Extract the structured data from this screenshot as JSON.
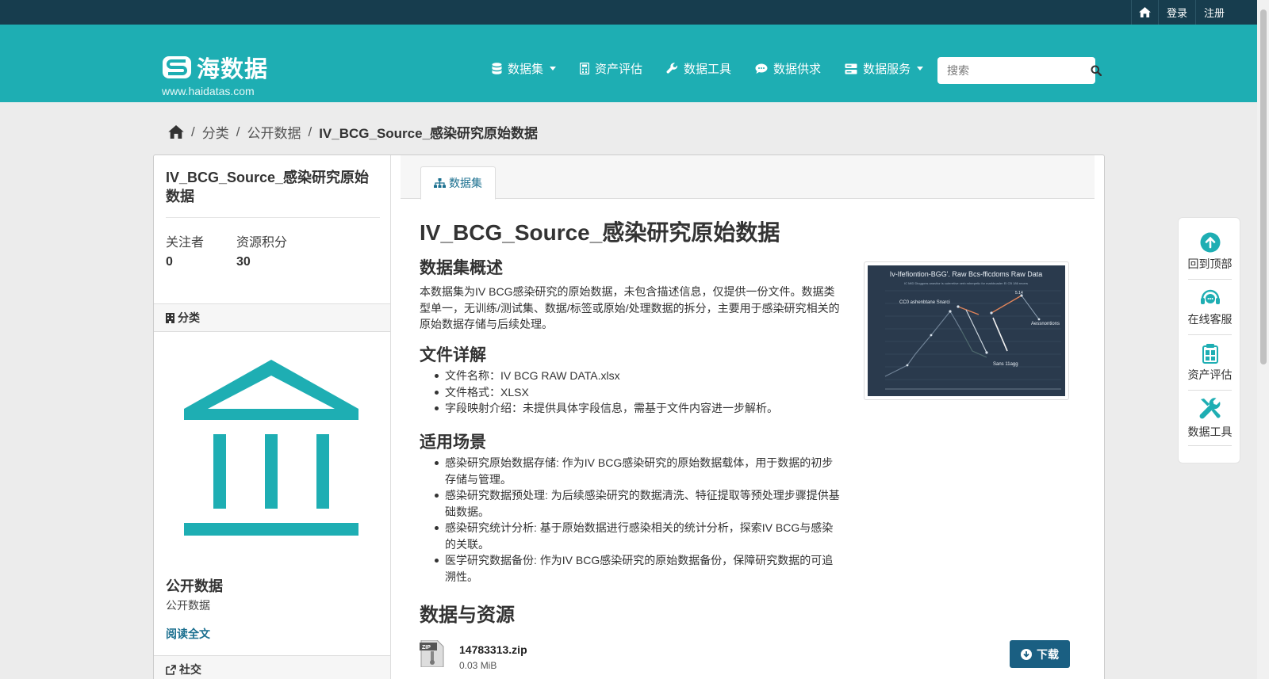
{
  "topbar": {
    "login": "登录",
    "register": "注册"
  },
  "header": {
    "logo_text": "海数据",
    "logo_url": "www.haidatas.com",
    "nav": [
      {
        "label": "数据集",
        "has_dropdown": true,
        "icon": "database-icon"
      },
      {
        "label": "资产评估",
        "has_dropdown": false,
        "icon": "calculator-icon"
      },
      {
        "label": "数据工具",
        "has_dropdown": false,
        "icon": "wrench-icon"
      },
      {
        "label": "数据供求",
        "has_dropdown": false,
        "icon": "comment-icon"
      },
      {
        "label": "数据服务",
        "has_dropdown": true,
        "icon": "server-icon"
      }
    ],
    "search_placeholder": "搜索"
  },
  "breadcrumb": [
    "分类",
    "公开数据",
    "IV_BCG_Source_感染研究原始数据"
  ],
  "sidebar": {
    "title": "IV_BCG_Source_感染研究原始数据",
    "followers_label": "关注者",
    "followers_value": "0",
    "points_label": "资源积分",
    "points_value": "30",
    "category_heading": "分类",
    "org_name": "公开数据",
    "org_desc": "公开数据",
    "read_more": "阅读全文",
    "social_heading": "社交"
  },
  "content": {
    "tab_label": "数据集",
    "title": "IV_BCG_Source_感染研究原始数据",
    "overview_heading": "数据集概述",
    "overview_text": "本数据集为IV BCG感染研究的原始数据，未包含描述信息，仅提供一份文件。数据类型单一，无训练/测试集、数据/标签或原始/处理数据的拆分，主要用于感染研究相关的原始数据存储与后续处理。",
    "file_heading": "文件详解",
    "file_items": [
      "文件名称：IV BCG RAW DATA.xlsx",
      "文件格式：XLSX",
      "字段映射介绍：未提供具体字段信息，需基于文件内容进一步解析。"
    ],
    "usage_heading": "适用场景",
    "usage_items": [
      "感染研究原始数据存储: 作为IV BCG感染研究的原始数据载体，用于数据的初步存储与管理。",
      "感染研究数据预处理: 为后续感染研究的数据清洗、特征提取等预处理步骤提供基础数据。",
      "感染研究统计分析: 基于原始数据进行感染相关的统计分析，探索IV BCG与感染的关联。",
      "医学研究数据备份: 作为IV BCG感染研究的原始数据备份，保障研究数据的可追溯性。"
    ],
    "resources_heading": "数据与资源",
    "resource": {
      "name": "14783313.zip",
      "size": "0.03 MiB",
      "download": "下载",
      "file_badge": "ZIP"
    },
    "thumb": {
      "title": "Iv-Ifefiontion-BGG'. Raw Bcs-fficdoms Raw Data",
      "subtitle": "IC MID Dioggons anavitor is cuterrrtive verb mherpetic for markbuader EI CB 186 recers",
      "label_left": "CC0 ashenbtane Snarci",
      "label_right": "Aessnontions",
      "label_bottom": "Sans 11agg",
      "label_top": "5.14"
    }
  },
  "float_bar": [
    "回到顶部",
    "在线客服",
    "资产评估",
    "数据工具"
  ]
}
